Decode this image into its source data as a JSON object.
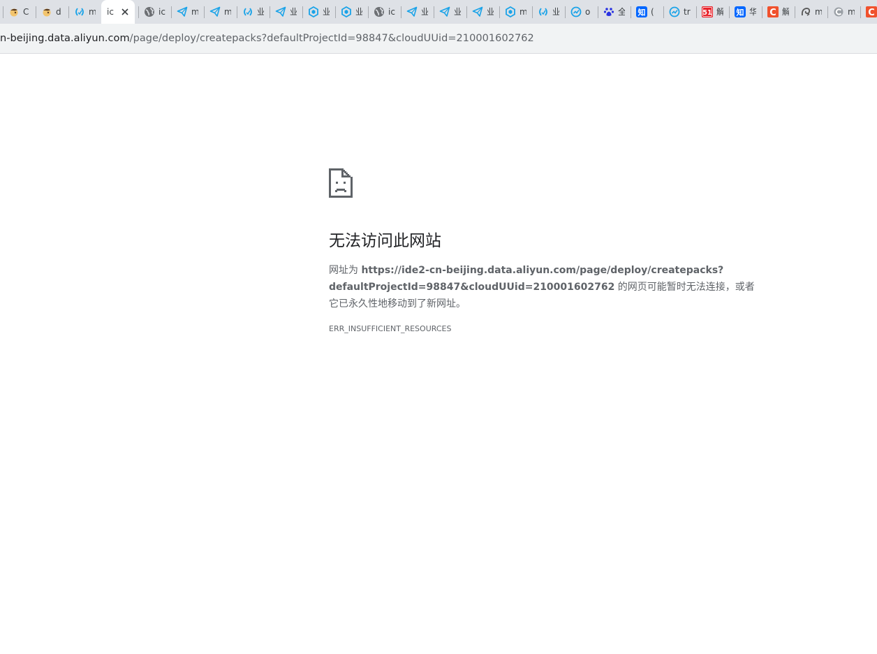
{
  "colors": {
    "tabstrip_bg": "#dee1e6",
    "toolbar_bg": "#f1f3f4",
    "text_primary": "#202124",
    "text_secondary": "#5f6368"
  },
  "tabs": [
    {
      "icon": "squirrel-icon",
      "title": "C"
    },
    {
      "icon": "squirrel-icon",
      "title": "d"
    },
    {
      "icon": "code-brackets-icon",
      "title": "m"
    },
    {
      "icon": "none",
      "title": "ic",
      "active": true
    },
    {
      "icon": "globe-icon",
      "title": "ic"
    },
    {
      "icon": "paper-plane-icon",
      "title": "m"
    },
    {
      "icon": "paper-plane-icon",
      "title": "m"
    },
    {
      "icon": "code-brackets-icon",
      "title": "业"
    },
    {
      "icon": "paper-plane-icon",
      "title": "业"
    },
    {
      "icon": "hexagon-icon",
      "title": "业"
    },
    {
      "icon": "hexagon-icon",
      "title": "业"
    },
    {
      "icon": "globe-icon",
      "title": "ic"
    },
    {
      "icon": "paper-plane-icon",
      "title": "业"
    },
    {
      "icon": "paper-plane-icon",
      "title": "业"
    },
    {
      "icon": "paper-plane-icon",
      "title": "业"
    },
    {
      "icon": "hexagon-icon",
      "title": "m"
    },
    {
      "icon": "code-brackets-icon",
      "title": "业"
    },
    {
      "icon": "trend-circle-icon",
      "title": "o"
    },
    {
      "icon": "paw-icon",
      "title": "全"
    },
    {
      "icon": "zhihu-icon",
      "title": "("
    },
    {
      "icon": "trend-circle-icon",
      "title": "tr"
    },
    {
      "icon": "badge-51-icon",
      "title": "解"
    },
    {
      "icon": "zhihu-icon",
      "title": "华"
    },
    {
      "icon": "csdn-c-icon",
      "title": "解"
    },
    {
      "icon": "swirl-icon",
      "title": "m"
    },
    {
      "icon": "c-gray-icon",
      "title": "m"
    },
    {
      "icon": "csdn-c-icon",
      "title": ""
    }
  ],
  "address_bar": {
    "host": "n-beijing.data.aliyun.com",
    "path": "/page/deploy/createpacks?defaultProjectId=98847&cloudUUid=210001602762"
  },
  "error_page": {
    "title": "无法访问此网站",
    "desc_prefix": "网址为 ",
    "desc_url_line1": "https://ide2-cn-beijing.data.aliyun.com/page/deploy/createpacks?",
    "desc_url_line2": "defaultProjectId=98847&cloudUUid=210001602762",
    "desc_suffix": " 的网页可能暂时无法连接，或者它已永久性地移动到了新网址。",
    "error_code": "ERR_INSUFFICIENT_RESOURCES"
  }
}
